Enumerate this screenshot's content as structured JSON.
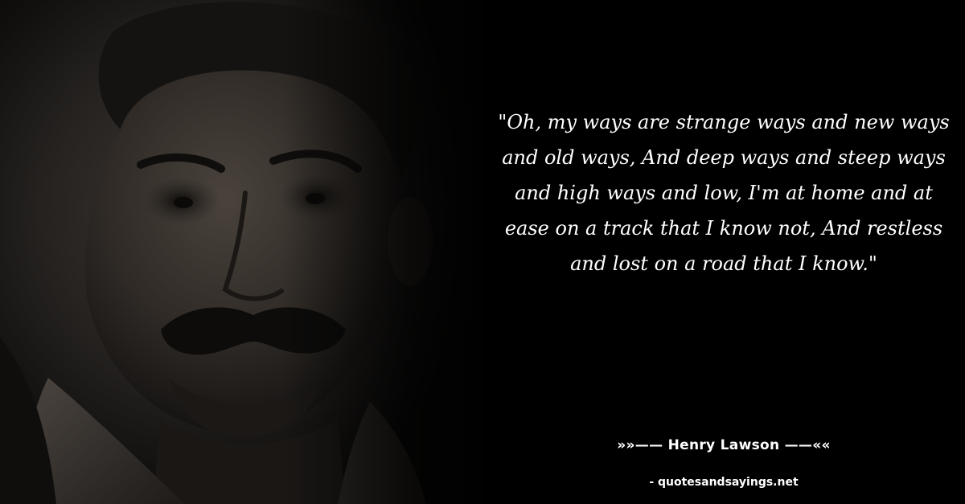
{
  "quote": {
    "text": "\"Oh, my ways are strange ways and new ways and old ways, And deep ways and steep ways and high ways and low, I'm at home and at ease on a track that I know not, And restless and lost on a road that I know.\""
  },
  "author": {
    "line": "»»—— Henry Lawson ——««"
  },
  "source": {
    "credit": "- quotesandsayings.net"
  },
  "colors": {
    "background": "#000000",
    "text": "#ffffff"
  }
}
